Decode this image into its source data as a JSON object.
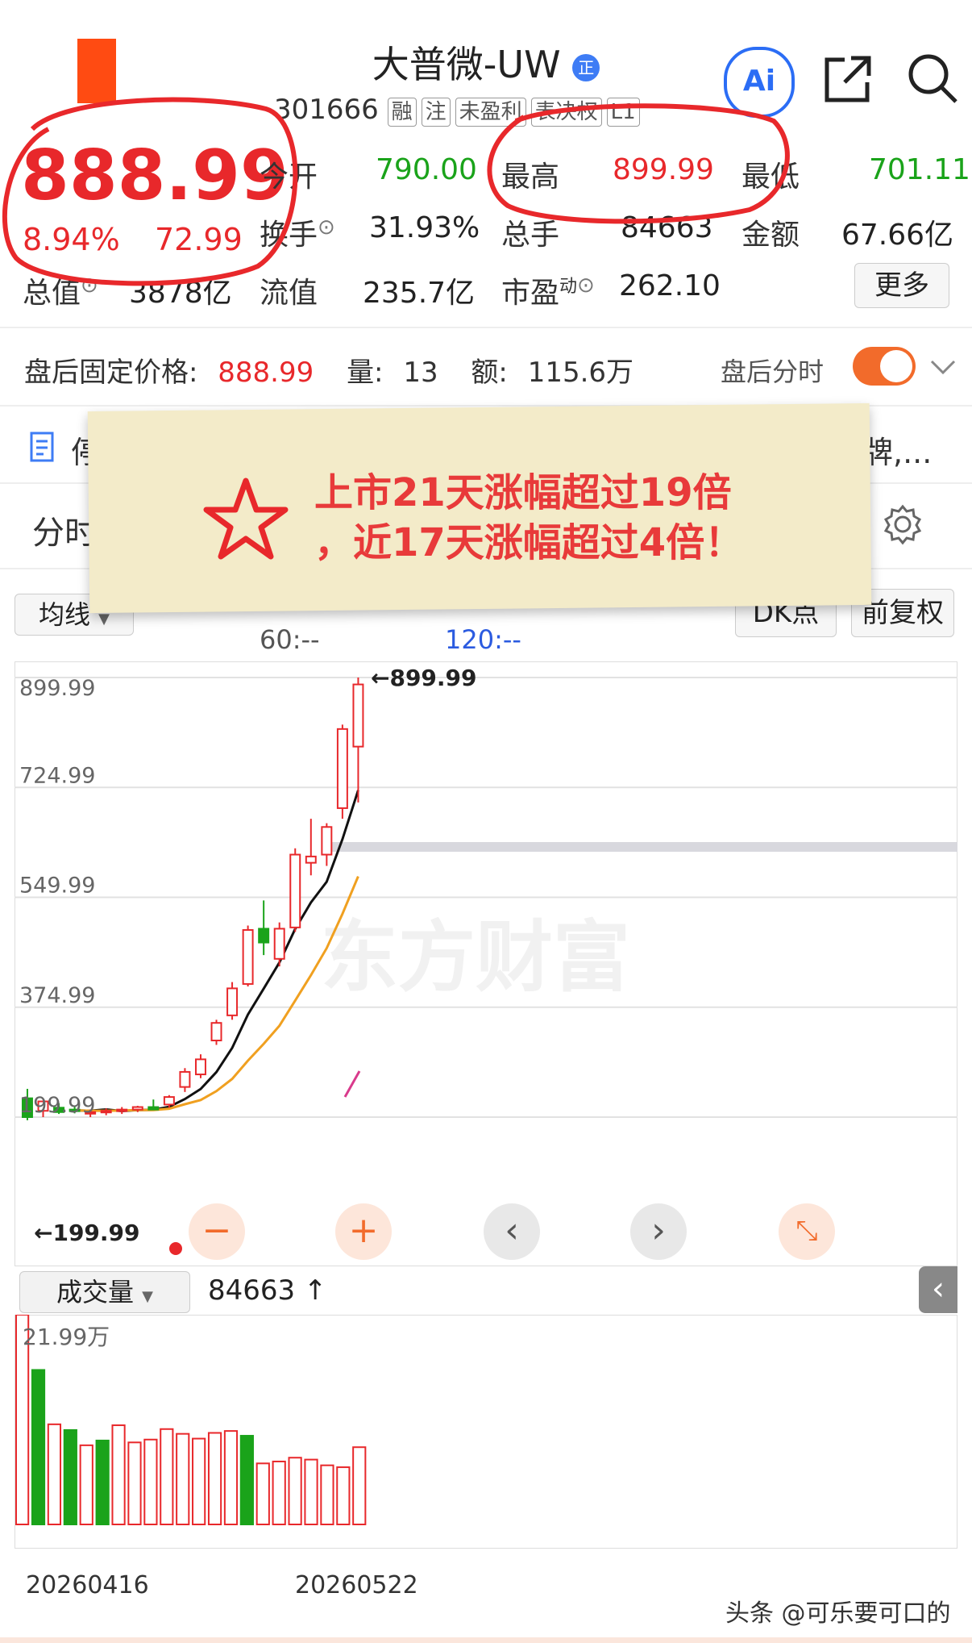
{
  "header": {
    "title": "大普微-UW",
    "title_badge": "正",
    "code": "301666",
    "tags": [
      "融",
      "注",
      "未盈利",
      "表决权",
      "L1"
    ],
    "ai_label": "Ai"
  },
  "quote": {
    "price": "888.99",
    "change_pct": "8.94%",
    "change_abs": "72.99",
    "open_label": "今开",
    "open_value": "790.00",
    "high_label": "最高",
    "high_value": "899.99",
    "low_label": "最低",
    "low_value": "701.11",
    "turnover_label": "换手",
    "turnover_value": "31.93%",
    "volume_label": "总手",
    "volume_value": "84663",
    "amount_label": "金额",
    "amount_value": "67.66亿",
    "mktcap_label": "总值",
    "mktcap_value": "3878亿",
    "float_label": "流值",
    "float_value": "235.7亿",
    "pe_label": "市盈",
    "pe_sup": "动",
    "pe_value": "262.10",
    "more_label": "更多"
  },
  "after_hours": {
    "label": "盘后固定价格:",
    "price": "888.99",
    "vol_label": "量:",
    "vol_value": "13",
    "amt_label": "额:",
    "amt_value": "115.6万",
    "toggle_label": "盘后分时"
  },
  "news_line": {
    "text_left": "停复牌",
    "text_right": "牌,..."
  },
  "tabs": {
    "first": "分时"
  },
  "sticky_note": {
    "line1": "上市21天涨幅超过19倍",
    "line2": "，近17天涨幅超过4倍！"
  },
  "chart_controls": {
    "ma_select": "均线",
    "ma60": "60:--",
    "ma120": "120:--",
    "dk_label": "DK点",
    "fq_label": "前复权"
  },
  "chart_data": [
    {
      "type": "candlestick",
      "yticks": [
        "899.99",
        "724.99",
        "549.99",
        "374.99",
        "199.99"
      ],
      "ylim": [
        199.99,
        899.99
      ],
      "high_marker": "899.99",
      "low_marker": "199.99",
      "watermark": "东方财富",
      "candles": [
        {
          "o": 230,
          "h": 245,
          "l": 195,
          "c": 200
        },
        {
          "o": 210,
          "h": 225,
          "l": 200,
          "c": 225
        },
        {
          "o": 215,
          "h": 222,
          "l": 205,
          "c": 208
        },
        {
          "o": 212,
          "h": 218,
          "l": 206,
          "c": 210
        },
        {
          "o": 206,
          "h": 212,
          "l": 200,
          "c": 208
        },
        {
          "o": 208,
          "h": 214,
          "l": 203,
          "c": 210
        },
        {
          "o": 210,
          "h": 216,
          "l": 205,
          "c": 212
        },
        {
          "o": 212,
          "h": 218,
          "l": 208,
          "c": 216
        },
        {
          "o": 216,
          "h": 228,
          "l": 212,
          "c": 212
        },
        {
          "o": 220,
          "h": 235,
          "l": 215,
          "c": 232
        },
        {
          "o": 248,
          "h": 278,
          "l": 240,
          "c": 272
        },
        {
          "o": 268,
          "h": 300,
          "l": 262,
          "c": 292
        },
        {
          "o": 322,
          "h": 355,
          "l": 315,
          "c": 350
        },
        {
          "o": 362,
          "h": 415,
          "l": 355,
          "c": 405
        },
        {
          "o": 412,
          "h": 505,
          "l": 408,
          "c": 498
        },
        {
          "o": 500,
          "h": 545,
          "l": 458,
          "c": 478
        },
        {
          "o": 452,
          "h": 510,
          "l": 440,
          "c": 500
        },
        {
          "o": 502,
          "h": 628,
          "l": 495,
          "c": 618
        },
        {
          "o": 605,
          "h": 675,
          "l": 585,
          "c": 615
        },
        {
          "o": 618,
          "h": 668,
          "l": 600,
          "c": 662
        },
        {
          "o": 692,
          "h": 825,
          "l": 675,
          "c": 818
        },
        {
          "o": 790,
          "h": 899.99,
          "l": 701.11,
          "c": 888.99
        }
      ]
    },
    {
      "type": "bar",
      "title": "成交量",
      "current": "84663",
      "ymax_label": "21.99万",
      "x_tick_labels": [
        "20260416",
        "20260522"
      ],
      "values": [
        21.99,
        16.2,
        10.5,
        9.9,
        8.3,
        8.8,
        10.4,
        8.6,
        8.9,
        10.0,
        9.5,
        9.0,
        9.6,
        9.8,
        9.3,
        6.4,
        6.6,
        7.0,
        6.8,
        6.2,
        6.0,
        8.1
      ],
      "colors": [
        "up",
        "down",
        "up",
        "down",
        "up",
        "down",
        "up",
        "up",
        "up",
        "up",
        "up",
        "up",
        "up",
        "up",
        "down",
        "up",
        "up",
        "up",
        "up",
        "up",
        "up",
        "up"
      ]
    }
  ],
  "chart_buttons": {
    "zoom_out": "−",
    "zoom_in": "+",
    "prev": "‹",
    "next": "›",
    "collapse": "‹"
  },
  "footer": {
    "watermark": "头条 @可乐要可口的"
  },
  "colors": {
    "up": "#e8282b",
    "down": "#1aa31a",
    "ma5": "#111111",
    "ma10": "#f0a020"
  }
}
